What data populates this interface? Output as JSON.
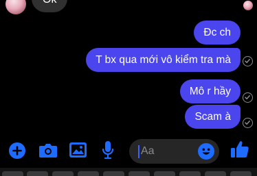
{
  "conversation": {
    "incoming": [
      {
        "text": "Ok"
      }
    ],
    "outgoing": [
      {
        "text": "Đc ch"
      },
      {
        "text": "T bx qua mới vô kiểm tra mà"
      },
      {
        "text": "Mô r hầy"
      },
      {
        "text": "Scam à"
      }
    ]
  },
  "composer": {
    "placeholder": "Aa",
    "icons": [
      "plus-icon",
      "camera-icon",
      "image-icon",
      "microphone-icon",
      "emoji-icon",
      "thumbs-up-icon"
    ]
  },
  "colors": {
    "background": "#000000",
    "outgoing_bubble": "#4b45ee",
    "incoming_bubble": "#303030",
    "accent": "#1e6bff",
    "input_background": "#262626",
    "placeholder": "#8a8a8e"
  }
}
